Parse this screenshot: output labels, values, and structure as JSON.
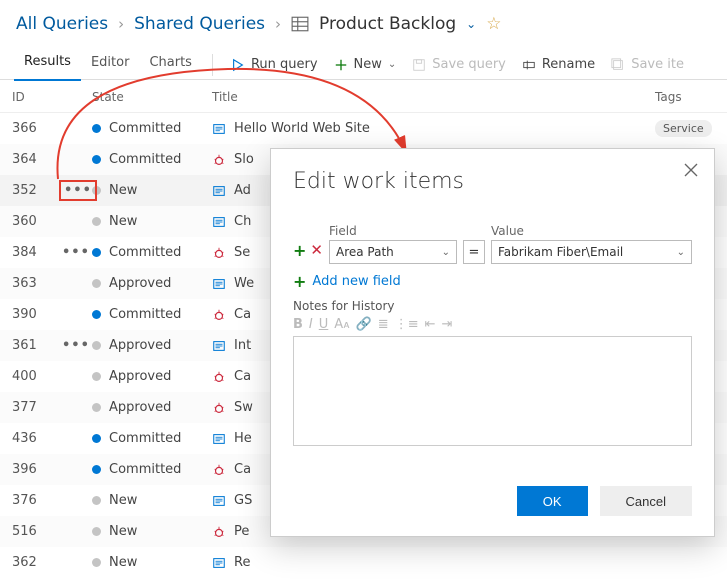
{
  "breadcrumb": {
    "all_queries": "All Queries",
    "shared_queries": "Shared Queries",
    "page_title": "Product Backlog"
  },
  "tabs": {
    "results": "Results",
    "editor": "Editor",
    "charts": "Charts"
  },
  "toolbar": {
    "run_query": "Run query",
    "new": "New",
    "save_query": "Save query",
    "rename": "Rename",
    "save_items": "Save ite"
  },
  "columns": {
    "id": "ID",
    "state": "State",
    "title": "Title",
    "tags": "Tags"
  },
  "states": {
    "committed": "Committed",
    "new": "New",
    "approved": "Approved"
  },
  "rows": [
    {
      "id": "366",
      "state": "committed",
      "icon": "pbi",
      "title": "Hello World Web Site",
      "tags": "Service"
    },
    {
      "id": "364",
      "state": "committed",
      "icon": "bug",
      "title": "Slo"
    },
    {
      "id": "352",
      "state": "new",
      "icon": "pbi",
      "title": "Ad",
      "dots": true,
      "hl": true
    },
    {
      "id": "360",
      "state": "new",
      "icon": "pbi",
      "title": "Ch"
    },
    {
      "id": "384",
      "state": "committed",
      "icon": "bug",
      "title": "Se",
      "dots": true
    },
    {
      "id": "363",
      "state": "approved",
      "icon": "pbi",
      "title": "We"
    },
    {
      "id": "390",
      "state": "committed",
      "icon": "bug",
      "title": "Ca"
    },
    {
      "id": "361",
      "state": "approved",
      "icon": "pbi",
      "title": "Int",
      "dots": true
    },
    {
      "id": "400",
      "state": "approved",
      "icon": "bug",
      "title": "Ca"
    },
    {
      "id": "377",
      "state": "approved",
      "icon": "bug",
      "title": "Sw"
    },
    {
      "id": "436",
      "state": "committed",
      "icon": "pbi",
      "title": "He"
    },
    {
      "id": "396",
      "state": "committed",
      "icon": "bug",
      "title": "Ca"
    },
    {
      "id": "376",
      "state": "new",
      "icon": "pbi",
      "title": "GS"
    },
    {
      "id": "516",
      "state": "new",
      "icon": "bug",
      "title": "Pe"
    },
    {
      "id": "362",
      "state": "new",
      "icon": "pbi",
      "title": "Re"
    }
  ],
  "dialog": {
    "title": "Edit work items",
    "field_label": "Field",
    "value_label": "Value",
    "field_value": "Area Path",
    "operator": "=",
    "value_value": "Fabrikam Fiber\\Email",
    "add_field": "Add new field",
    "notes_label": "Notes for History",
    "ok": "OK",
    "cancel": "Cancel"
  }
}
